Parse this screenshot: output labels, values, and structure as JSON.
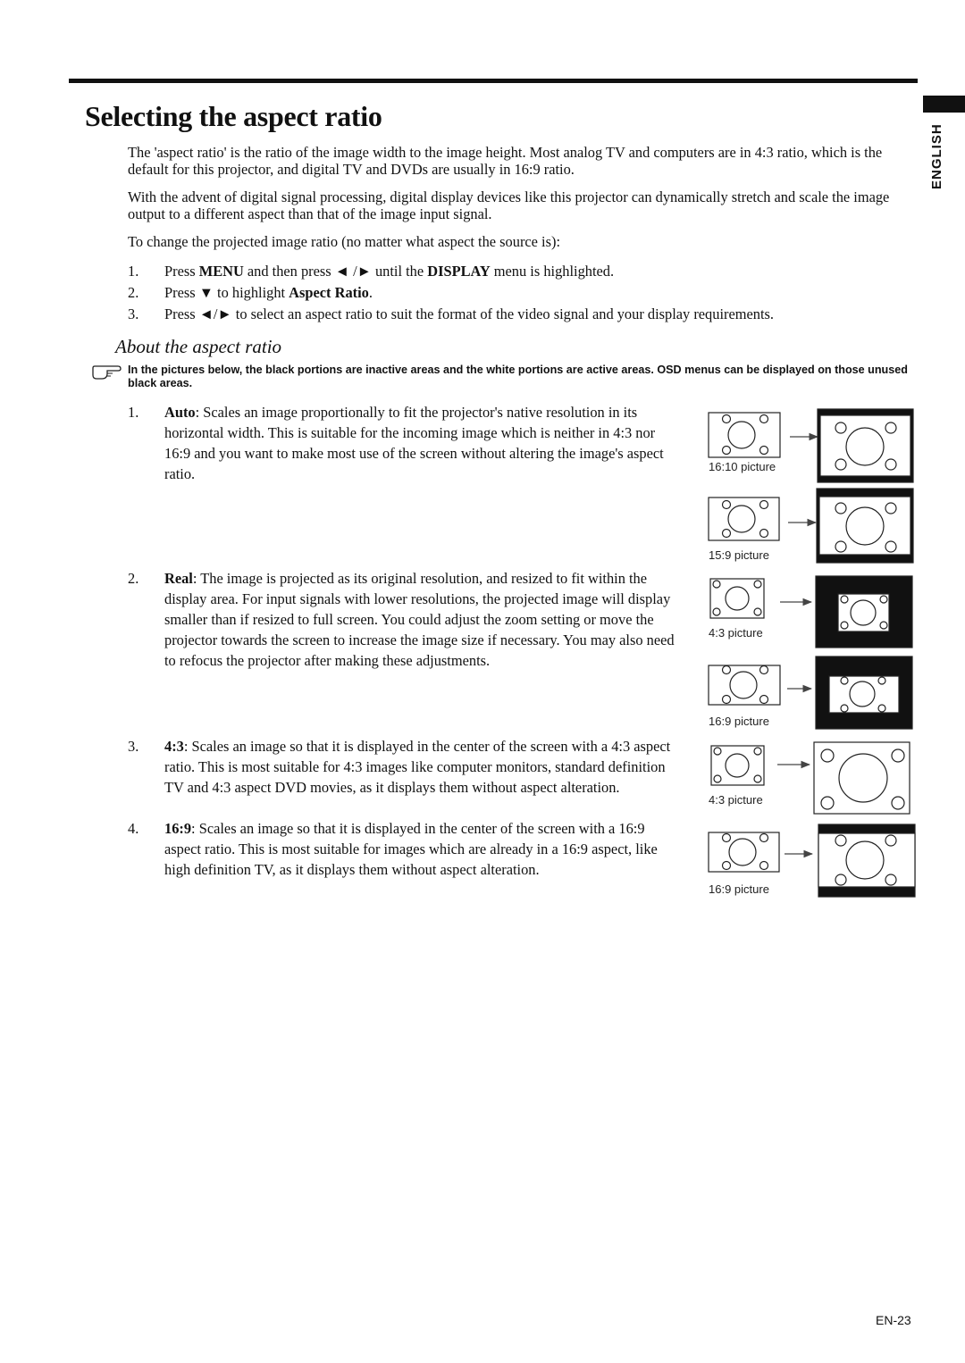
{
  "header": {
    "language_tab": "ENGLISH"
  },
  "title": "Selecting the aspect ratio",
  "intro": {
    "p1": "The 'aspect ratio' is the ratio of the image width to the image height. Most analog TV and computers are in 4:3 ratio, which is the default for this projector, and digital TV and DVDs are usually in 16:9 ratio.",
    "p2": "With the advent of digital signal processing, digital display devices like this projector can dynamically stretch and scale the image output to a different aspect than that of the image input signal.",
    "p3": "To change the projected image ratio (no matter what aspect the source is):"
  },
  "steps": [
    {
      "num": "1.",
      "pre": "Press ",
      "b1": "MENU",
      "mid": " and then press ◄ /►  until the ",
      "b2": "DISPLAY",
      "post": " menu is highlighted."
    },
    {
      "num": "2.",
      "pre": "Press ▼ to highlight ",
      "b1": "Aspect Ratio",
      "mid": ".",
      "b2": "",
      "post": ""
    },
    {
      "num": "3.",
      "pre": "Press ◄/► to select an aspect ratio to suit the format of the video signal and your display requirements.",
      "b1": "",
      "mid": "",
      "b2": "",
      "post": ""
    }
  ],
  "subtitle": "About the aspect ratio",
  "note": "In the pictures below, the black portions are inactive areas and the white portions are active areas. OSD menus can be displayed on those unused black areas.",
  "modes": [
    {
      "num": "1.",
      "name": "Auto",
      "desc": ": Scales an image proportionally to fit the projector's native resolution in its horizontal width. This is suitable for the incoming image which is neither in 4:3 nor 16:9 and you want to make most use of the screen without altering the image's aspect ratio."
    },
    {
      "num": "2.",
      "name": "Real",
      "desc": ": The image is projected as its original resolution, and resized to fit within the display area. For input signals with lower resolutions, the projected image will display smaller than if resized to full screen. You could adjust the zoom setting or move the projector towards the screen to increase the image size if necessary. You may also need to refocus the projector after making these adjustments."
    },
    {
      "num": "3.",
      "name": "4:3",
      "desc": ": Scales an image so that it is displayed in the center of the screen with a 4:3 aspect ratio. This is most suitable for 4:3 images like computer monitors, standard definition TV and 4:3 aspect DVD movies, as it displays them without aspect alteration."
    },
    {
      "num": "4.",
      "name": "16:9",
      "desc": ": Scales an image so that it is displayed in the center of the screen with a 16:9 aspect ratio. This is most suitable for images which are already in a 16:9 aspect, like high definition TV, as it displays them without aspect alteration."
    }
  ],
  "figures": [
    {
      "caption": "16:10 picture"
    },
    {
      "caption": "15:9 picture"
    },
    {
      "caption": "4:3 picture"
    },
    {
      "caption": "16:9 picture"
    },
    {
      "caption": "4:3 picture"
    },
    {
      "caption": "16:9 picture"
    }
  ],
  "footer": {
    "page_number": "EN-23"
  }
}
